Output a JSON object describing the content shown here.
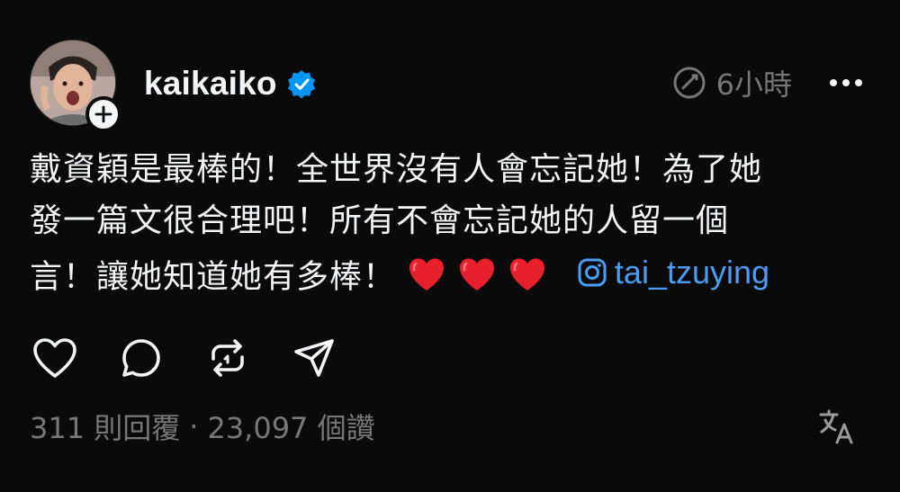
{
  "post": {
    "author": {
      "username": "kaikaiko",
      "verified": true,
      "avatar_icon": "avatar-photo",
      "follow_icon": "plus-icon"
    },
    "timestamp": "6小時",
    "more_icon": "more-horizontal-icon",
    "body": {
      "line1": "戴資穎是最棒的！全世界沒有人會忘記她！為了她",
      "line2": "發一篇文很合理吧！所有不會忘記她的人留一個",
      "line3_text": "言！讓她知道她有多棒！",
      "hearts": 3,
      "mention": "tai_tzuying"
    },
    "actions": [
      "heart-icon",
      "comment-icon",
      "repost-icon",
      "share-icon"
    ],
    "stats": {
      "replies": "311 則回覆",
      "separator": "·",
      "likes": "23,097 個讚"
    },
    "translate_icon": "translate-icon",
    "colors": {
      "background": "#0a0a0a",
      "text": "#f3f5f7",
      "muted": "#777777",
      "link": "#4a9cf5",
      "verified": "#0095f6",
      "heart": "#e8202e"
    }
  }
}
